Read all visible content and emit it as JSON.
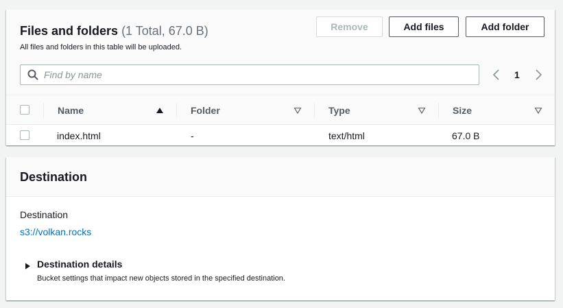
{
  "files_panel": {
    "title": "Files and folders",
    "count_text": "(1 Total, 67.0 B)",
    "description": "All files and folders in this table will be uploaded.",
    "buttons": {
      "remove": "Remove",
      "add_files": "Add files",
      "add_folder": "Add folder"
    },
    "search": {
      "placeholder": "Find by name",
      "value": "",
      "icon": "search-icon"
    },
    "pagination": {
      "current_page": "1",
      "prev_icon": "chevron-left-icon",
      "next_icon": "chevron-right-icon"
    },
    "table": {
      "columns": [
        {
          "label": "Name",
          "sort": "ascending"
        },
        {
          "label": "Folder",
          "sort": "none"
        },
        {
          "label": "Type",
          "sort": "none"
        },
        {
          "label": "Size",
          "sort": "none"
        }
      ],
      "rows": [
        {
          "name": "index.html",
          "folder": "-",
          "type": "text/html",
          "size": "67.0 B",
          "selected": false
        }
      ]
    }
  },
  "destination_panel": {
    "title": "Destination",
    "label": "Destination",
    "link": "s3://volkan.rocks",
    "details": {
      "label": "Destination details",
      "description": "Bucket settings that impact new objects stored in the specified destination.",
      "expanded": false
    }
  },
  "colors": {
    "page_background": "#f2f3f3",
    "link": "#0073bb",
    "text": "#16191f",
    "muted_text": "#687078",
    "disabled_text": "#aab7b8"
  }
}
